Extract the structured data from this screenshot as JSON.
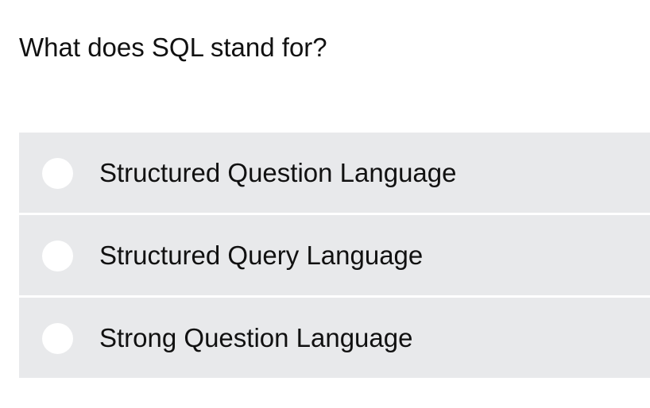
{
  "question": {
    "text": "What does SQL stand for?"
  },
  "options": [
    {
      "label": "Structured Question Language",
      "selected": false
    },
    {
      "label": "Structured Query Language",
      "selected": false
    },
    {
      "label": "Strong Question Language",
      "selected": false
    }
  ],
  "colors": {
    "option_background": "#e8e9eb",
    "radio_background": "#ffffff",
    "text": "#111111"
  }
}
